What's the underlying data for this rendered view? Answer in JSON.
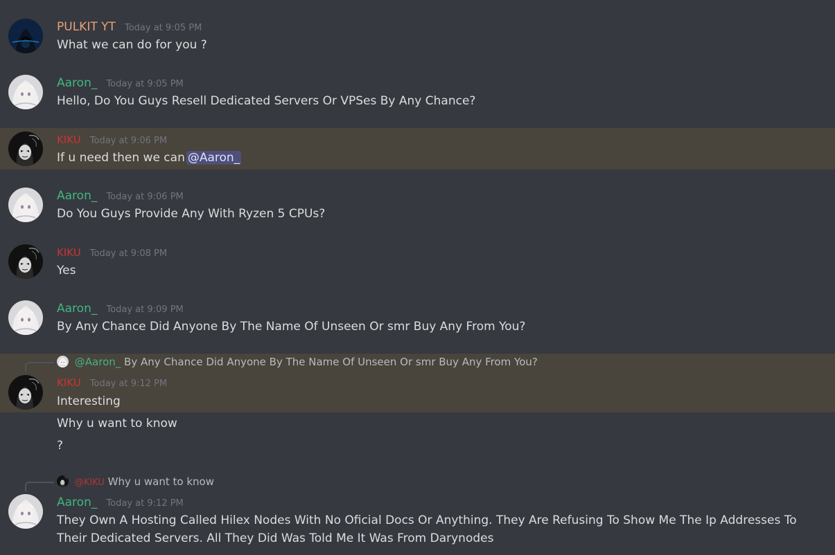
{
  "colors": {
    "background": "#36393f",
    "highlight": "#49443c",
    "pulkit": "#e8a07a",
    "aaron": "#43b581",
    "kiku": "#c93535",
    "timestamp": "#72767d",
    "mention_bg": "#4f5a9a"
  },
  "messages": [
    {
      "author": "PULKIT YT",
      "timestamp": "Today at 9:05 PM",
      "lines": [
        "What we can do for you ?"
      ],
      "avatar": "hooded-figure-avatar"
    },
    {
      "author": "Aaron_",
      "timestamp": "Today at 9:05 PM",
      "lines": [
        "Hello, Do You Guys Resell Dedicated Servers Or VPSes By Any Chance?"
      ],
      "avatar": "anime-girl-avatar"
    },
    {
      "author": "KIKU",
      "timestamp": "Today at 9:06 PM",
      "text_before_mention": "If u need then we can",
      "mention": "@Aaron_",
      "avatar": "masked-figure-avatar"
    },
    {
      "author": "Aaron_",
      "timestamp": "Today at 9:06 PM",
      "lines": [
        "Do You Guys Provide Any With Ryzen 5 CPUs?"
      ],
      "avatar": "anime-girl-avatar"
    },
    {
      "author": "KIKU",
      "timestamp": "Today at 9:08 PM",
      "lines": [
        "Yes"
      ],
      "avatar": "masked-figure-avatar"
    },
    {
      "author": "Aaron_",
      "timestamp": "Today at 9:09 PM",
      "lines": [
        "By Any Chance Did Anyone By The Name Of Unseen Or smr Buy Any From You?"
      ],
      "avatar": "anime-girl-avatar"
    },
    {
      "author": "KIKU",
      "timestamp": "Today at 9:12 PM",
      "reply_to": {
        "author": "@Aaron_",
        "text": "By Any Chance Did Anyone By The Name Of Unseen Or smr Buy Any From You?"
      },
      "lines": [
        "Interesting",
        "Why u want to know",
        "?"
      ],
      "avatar": "masked-figure-avatar"
    },
    {
      "author": "Aaron_",
      "timestamp": "Today at 9:12 PM",
      "reply_to": {
        "author": "@KIKU",
        "text": "Why u want to know"
      },
      "text": "They Own A Hosting Called Hilex Nodes With No Oficial Docs Or Anything. They Are Refusing To Show Me The Ip Addresses To Their Dedicated Servers. All They Did Was Told Me It Was From Darynodes",
      "avatar": "anime-girl-avatar"
    }
  ]
}
